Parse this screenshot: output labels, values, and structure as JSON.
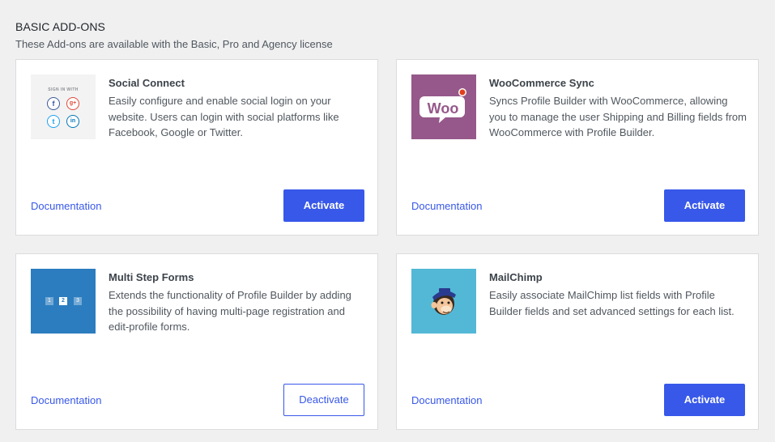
{
  "section": {
    "title": "BASIC ADD-ONS",
    "subtitle": "These Add-ons are available with the Basic, Pro and Agency license"
  },
  "colors": {
    "page_bg": "#f0f0f1",
    "accent": "#3858e9",
    "woo_brand": "#96588a",
    "multistep_brand": "#2b7dbf",
    "mailchimp_brand": "#53b8d6"
  },
  "addons": [
    {
      "title": "Social Connect",
      "description": "Easily configure and enable social login on your website. Users can login with social platforms like Facebook, Google or Twitter.",
      "doc_label": "Documentation",
      "action_label": "Activate",
      "thumb": {
        "label": "SIGN IN WITH",
        "icons": [
          "facebook-icon",
          "google-plus-icon",
          "twitter-icon",
          "linkedin-icon"
        ],
        "glyphs": [
          "f",
          "g+",
          "t",
          "in"
        ]
      }
    },
    {
      "title": "WooCommerce Sync",
      "description": "Syncs Profile Builder with WooCommerce, allowing you to manage the user Shipping and Billing fields from WooCommerce with Profile Builder.",
      "doc_label": "Documentation",
      "action_label": "Activate",
      "thumb": {
        "logo_text": "Woo"
      }
    },
    {
      "title": "Multi Step Forms",
      "description": "Extends the functionality of Profile Builder by adding the possibility of having multi-page registration and edit-profile forms.",
      "doc_label": "Documentation",
      "action_label": "Deactivate",
      "thumb": {
        "steps": [
          "1",
          "2",
          "3"
        ]
      }
    },
    {
      "title": "MailChimp",
      "description": "Easily associate MailChimp list fields with Profile Builder fields and set advanced settings for each list.",
      "doc_label": "Documentation",
      "action_label": "Activate",
      "thumb": {
        "icon": "mailchimp-freddie-icon"
      }
    }
  ]
}
